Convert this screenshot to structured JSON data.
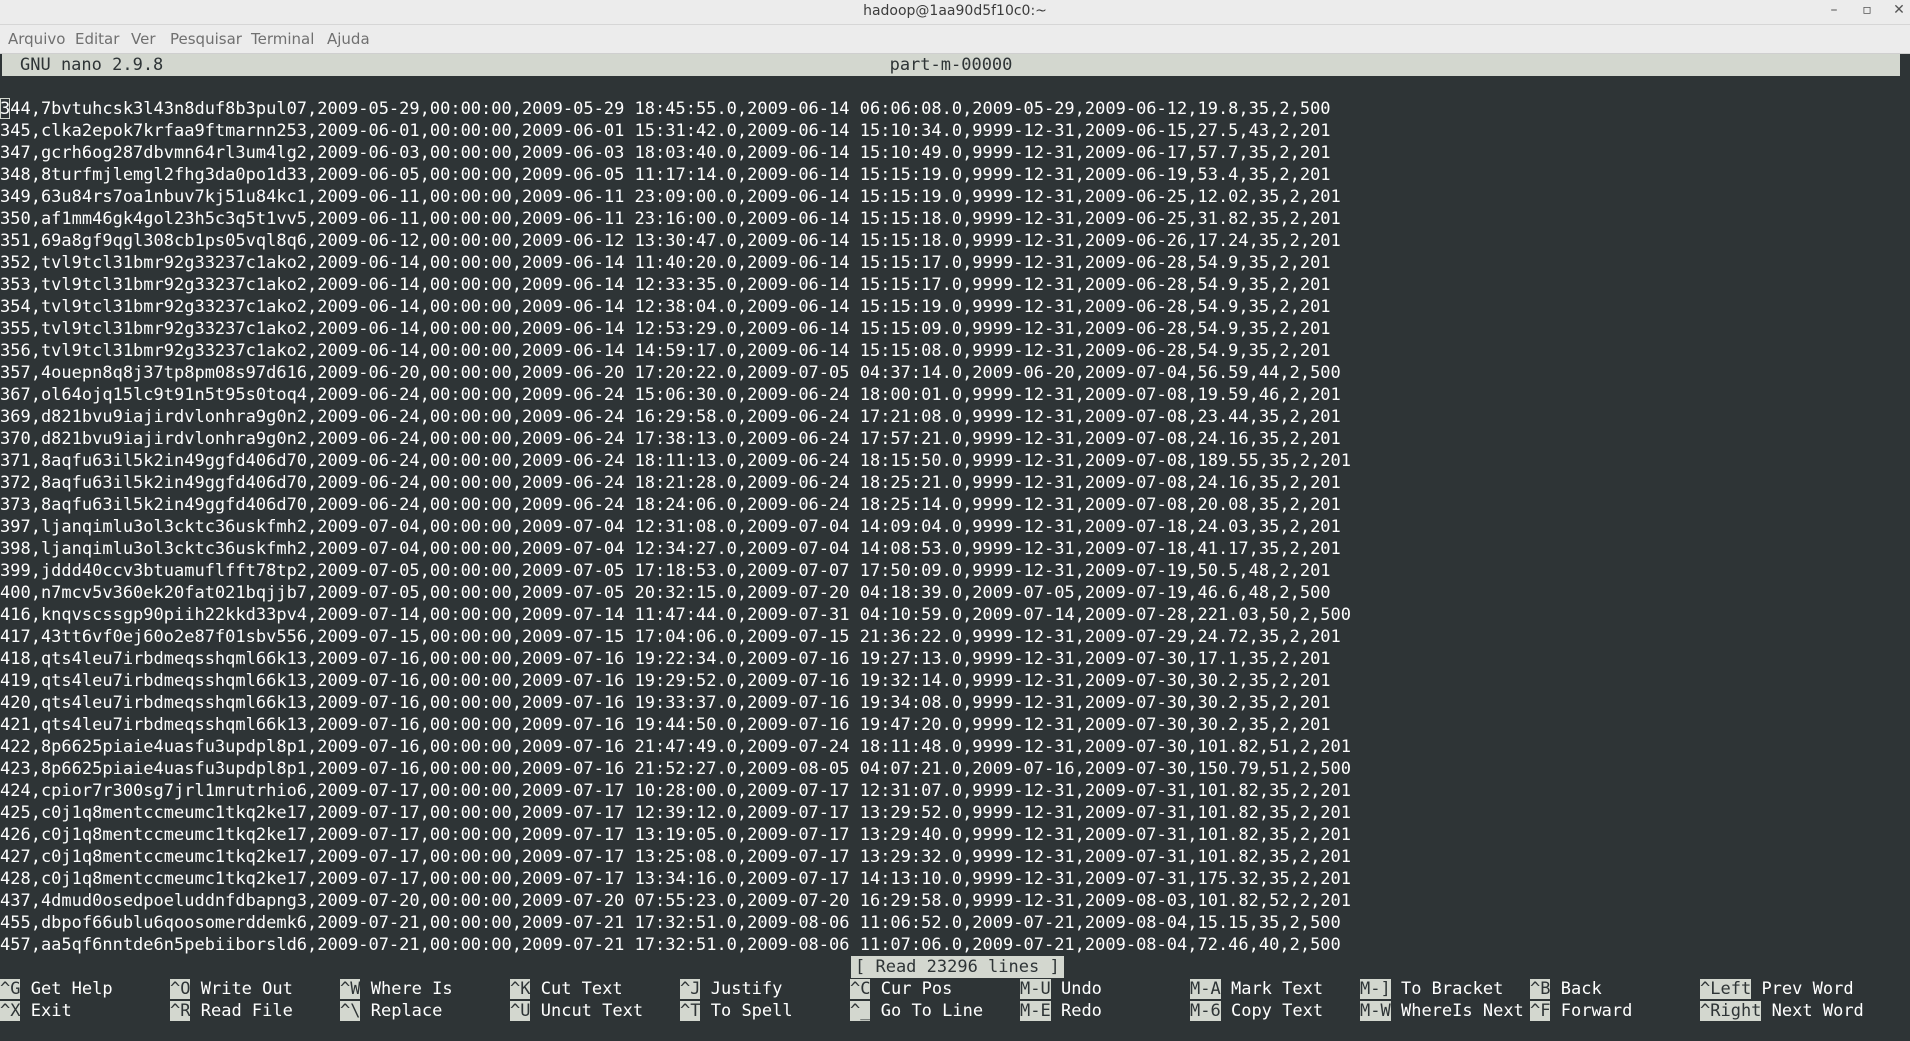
{
  "window": {
    "title": "hadoop@1aa90d5f10c0:~",
    "controls": [
      "–",
      "▫",
      "✕"
    ]
  },
  "menu": [
    "Arquivo",
    "Editar",
    "Ver",
    "Pesquisar",
    "Terminal",
    "Ajuda"
  ],
  "nano": {
    "version": "GNU nano 2.9.8",
    "filename": "part-m-00000",
    "status": "[ Read 23296 lines ]"
  },
  "lines": [
    "344,7bvtuhcsk3l43n8duf8b3pul07,2009-05-29,00:00:00,2009-05-29 18:45:55.0,2009-06-14 06:06:08.0,2009-05-29,2009-06-12,19.8,35,2,500",
    "345,clka2epok7krfaa9ftmarnn253,2009-06-01,00:00:00,2009-06-01 15:31:42.0,2009-06-14 15:10:34.0,9999-12-31,2009-06-15,27.5,43,2,201",
    "347,gcrh6og287dbvmn64rl3um4lg2,2009-06-03,00:00:00,2009-06-03 18:03:40.0,2009-06-14 15:10:49.0,9999-12-31,2009-06-17,57.7,35,2,201",
    "348,8turfmjlemgl2fhg3da0po1d33,2009-06-05,00:00:00,2009-06-05 11:17:14.0,2009-06-14 15:15:19.0,9999-12-31,2009-06-19,53.4,35,2,201",
    "349,63u84rs7oa1nbuv7kj51u84kc1,2009-06-11,00:00:00,2009-06-11 23:09:00.0,2009-06-14 15:15:19.0,9999-12-31,2009-06-25,12.02,35,2,201",
    "350,af1mm46gk4gol23h5c3q5t1vv5,2009-06-11,00:00:00,2009-06-11 23:16:00.0,2009-06-14 15:15:18.0,9999-12-31,2009-06-25,31.82,35,2,201",
    "351,69a8gf9qgl308cb1ps05vql8q6,2009-06-12,00:00:00,2009-06-12 13:30:47.0,2009-06-14 15:15:18.0,9999-12-31,2009-06-26,17.24,35,2,201",
    "352,tvl9tcl31bmr92g33237c1ako2,2009-06-14,00:00:00,2009-06-14 11:40:20.0,2009-06-14 15:15:17.0,9999-12-31,2009-06-28,54.9,35,2,201",
    "353,tvl9tcl31bmr92g33237c1ako2,2009-06-14,00:00:00,2009-06-14 12:33:35.0,2009-06-14 15:15:17.0,9999-12-31,2009-06-28,54.9,35,2,201",
    "354,tvl9tcl31bmr92g33237c1ako2,2009-06-14,00:00:00,2009-06-14 12:38:04.0,2009-06-14 15:15:19.0,9999-12-31,2009-06-28,54.9,35,2,201",
    "355,tvl9tcl31bmr92g33237c1ako2,2009-06-14,00:00:00,2009-06-14 12:53:29.0,2009-06-14 15:15:09.0,9999-12-31,2009-06-28,54.9,35,2,201",
    "356,tvl9tcl31bmr92g33237c1ako2,2009-06-14,00:00:00,2009-06-14 14:59:17.0,2009-06-14 15:15:08.0,9999-12-31,2009-06-28,54.9,35,2,201",
    "357,4ouepn8q8j37tp8pm08s97d616,2009-06-20,00:00:00,2009-06-20 17:20:22.0,2009-07-05 04:37:14.0,2009-06-20,2009-07-04,56.59,44,2,500",
    "367,ol64ojq15lc9t91n5t95s0toq4,2009-06-24,00:00:00,2009-06-24 15:06:30.0,2009-06-24 18:00:01.0,9999-12-31,2009-07-08,19.59,46,2,201",
    "369,d821bvu9iajirdvlonhra9g0n2,2009-06-24,00:00:00,2009-06-24 16:29:58.0,2009-06-24 17:21:08.0,9999-12-31,2009-07-08,23.44,35,2,201",
    "370,d821bvu9iajirdvlonhra9g0n2,2009-06-24,00:00:00,2009-06-24 17:38:13.0,2009-06-24 17:57:21.0,9999-12-31,2009-07-08,24.16,35,2,201",
    "371,8aqfu63il5k2in49ggfd406d70,2009-06-24,00:00:00,2009-06-24 18:11:13.0,2009-06-24 18:15:50.0,9999-12-31,2009-07-08,189.55,35,2,201",
    "372,8aqfu63il5k2in49ggfd406d70,2009-06-24,00:00:00,2009-06-24 18:21:28.0,2009-06-24 18:25:21.0,9999-12-31,2009-07-08,24.16,35,2,201",
    "373,8aqfu63il5k2in49ggfd406d70,2009-06-24,00:00:00,2009-06-24 18:24:06.0,2009-06-24 18:25:14.0,9999-12-31,2009-07-08,20.08,35,2,201",
    "397,ljanqimlu3ol3cktc36uskfmh2,2009-07-04,00:00:00,2009-07-04 12:31:08.0,2009-07-04 14:09:04.0,9999-12-31,2009-07-18,24.03,35,2,201",
    "398,ljanqimlu3ol3cktc36uskfmh2,2009-07-04,00:00:00,2009-07-04 12:34:27.0,2009-07-04 14:08:53.0,9999-12-31,2009-07-18,41.17,35,2,201",
    "399,jddd40ccv3btuamuflfft78tp2,2009-07-05,00:00:00,2009-07-05 17:18:53.0,2009-07-07 17:50:09.0,9999-12-31,2009-07-19,50.5,48,2,201",
    "400,n7mcv5v360ek20fat021bqjjb7,2009-07-05,00:00:00,2009-07-05 20:32:15.0,2009-07-20 04:18:39.0,2009-07-05,2009-07-19,46.6,48,2,500",
    "416,knqvscssgp90piih22kkd33pv4,2009-07-14,00:00:00,2009-07-14 11:47:44.0,2009-07-31 04:10:59.0,2009-07-14,2009-07-28,221.03,50,2,500",
    "417,43tt6vf0ej60o2e87f01sbv556,2009-07-15,00:00:00,2009-07-15 17:04:06.0,2009-07-15 21:36:22.0,9999-12-31,2009-07-29,24.72,35,2,201",
    "418,qts4leu7irbdmeqsshqml66k13,2009-07-16,00:00:00,2009-07-16 19:22:34.0,2009-07-16 19:27:13.0,9999-12-31,2009-07-30,17.1,35,2,201",
    "419,qts4leu7irbdmeqsshqml66k13,2009-07-16,00:00:00,2009-07-16 19:29:52.0,2009-07-16 19:32:14.0,9999-12-31,2009-07-30,30.2,35,2,201",
    "420,qts4leu7irbdmeqsshqml66k13,2009-07-16,00:00:00,2009-07-16 19:33:37.0,2009-07-16 19:34:08.0,9999-12-31,2009-07-30,30.2,35,2,201",
    "421,qts4leu7irbdmeqsshqml66k13,2009-07-16,00:00:00,2009-07-16 19:44:50.0,2009-07-16 19:47:20.0,9999-12-31,2009-07-30,30.2,35,2,201",
    "422,8p6625piaie4uasfu3updpl8p1,2009-07-16,00:00:00,2009-07-16 21:47:49.0,2009-07-24 18:11:48.0,9999-12-31,2009-07-30,101.82,51,2,201",
    "423,8p6625piaie4uasfu3updpl8p1,2009-07-16,00:00:00,2009-07-16 21:52:27.0,2009-08-05 04:07:21.0,2009-07-16,2009-07-30,150.79,51,2,500",
    "424,cpior7r300sg7jrl1mrutrhio6,2009-07-17,00:00:00,2009-07-17 10:28:00.0,2009-07-17 12:31:07.0,9999-12-31,2009-07-31,101.82,35,2,201",
    "425,c0j1q8mentccmeumc1tkq2ke17,2009-07-17,00:00:00,2009-07-17 12:39:12.0,2009-07-17 13:29:52.0,9999-12-31,2009-07-31,101.82,35,2,201",
    "426,c0j1q8mentccmeumc1tkq2ke17,2009-07-17,00:00:00,2009-07-17 13:19:05.0,2009-07-17 13:29:40.0,9999-12-31,2009-07-31,101.82,35,2,201",
    "427,c0j1q8mentccmeumc1tkq2ke17,2009-07-17,00:00:00,2009-07-17 13:25:08.0,2009-07-17 13:29:32.0,9999-12-31,2009-07-31,101.82,35,2,201",
    "428,c0j1q8mentccmeumc1tkq2ke17,2009-07-17,00:00:00,2009-07-17 13:34:16.0,2009-07-17 14:13:10.0,9999-12-31,2009-07-31,175.32,35,2,201",
    "437,4dmud0osedpoeluddnfdbapng3,2009-07-20,00:00:00,2009-07-20 07:55:23.0,2009-07-20 16:29:58.0,9999-12-31,2009-08-03,101.82,52,2,201",
    "455,dbpof66ublu6qoosomerddemk6,2009-07-21,00:00:00,2009-07-21 17:32:51.0,2009-08-06 11:06:52.0,2009-07-21,2009-08-04,15.15,35,2,500",
    "457,aa5qf6nntde6n5pebiiborsld6,2009-07-21,00:00:00,2009-07-21 17:32:51.0,2009-08-06 11:07:06.0,2009-07-21,2009-08-04,72.46,40,2,500"
  ],
  "shortcuts": {
    "row1": [
      {
        "key": "^G",
        "label": "Get Help"
      },
      {
        "key": "^O",
        "label": "Write Out"
      },
      {
        "key": "^W",
        "label": "Where Is"
      },
      {
        "key": "^K",
        "label": "Cut Text"
      },
      {
        "key": "^J",
        "label": "Justify"
      },
      {
        "key": "^C",
        "label": "Cur Pos"
      },
      {
        "key": "M-U",
        "label": "Undo"
      },
      {
        "key": "M-A",
        "label": "Mark Text"
      },
      {
        "key": "M-]",
        "label": "To Bracket"
      },
      {
        "key": "^B",
        "label": "Back"
      },
      {
        "key": "^Left",
        "label": "Prev Word"
      }
    ],
    "row2": [
      {
        "key": "^X",
        "label": "Exit"
      },
      {
        "key": "^R",
        "label": "Read File"
      },
      {
        "key": "^\\",
        "label": "Replace"
      },
      {
        "key": "^U",
        "label": "Uncut Text"
      },
      {
        "key": "^T",
        "label": "To Spell"
      },
      {
        "key": "^_",
        "label": "Go To Line"
      },
      {
        "key": "M-E",
        "label": "Redo"
      },
      {
        "key": "M-6",
        "label": "Copy Text"
      },
      {
        "key": "M-W",
        "label": "WhereIs Next"
      },
      {
        "key": "^F",
        "label": "Forward"
      },
      {
        "key": "^Right",
        "label": "Next Word"
      }
    ]
  }
}
